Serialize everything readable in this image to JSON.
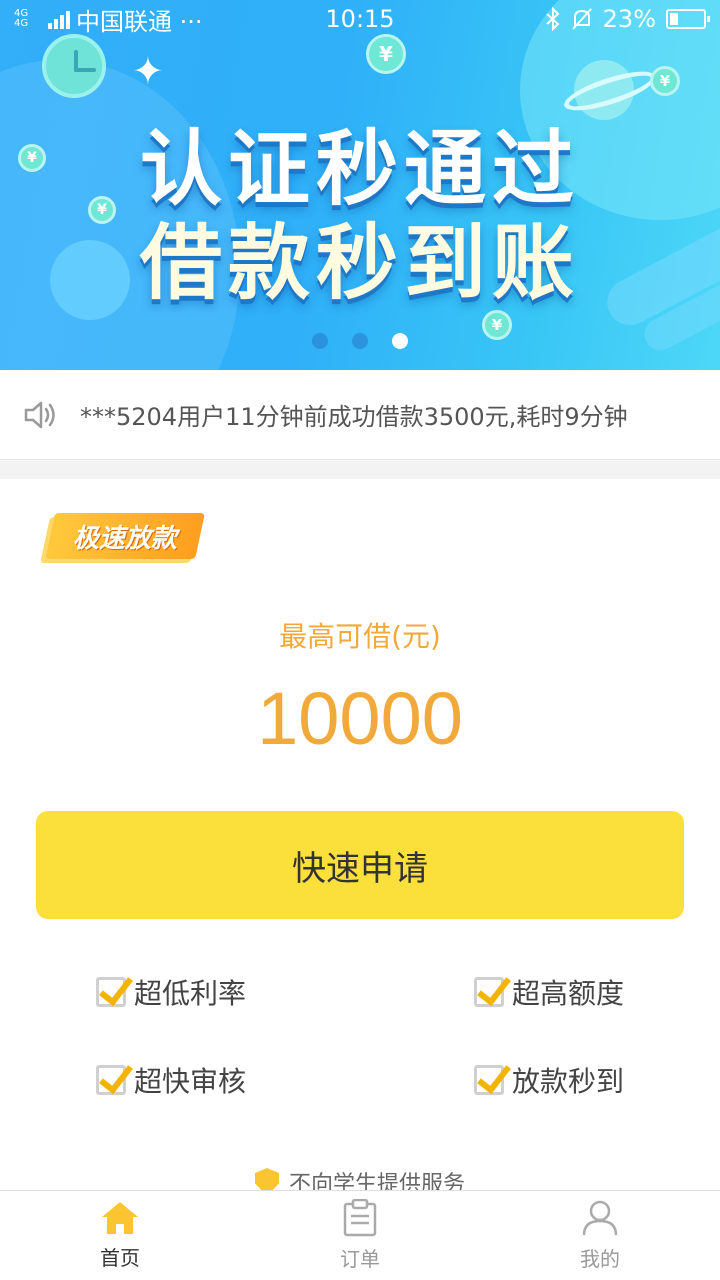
{
  "status_bar": {
    "network": "4G 4G",
    "carrier": "中国联通 ···",
    "time": "10:15",
    "battery": "23%"
  },
  "banner": {
    "line1": "认证秒通过",
    "line2": "借款秒到账",
    "coin_symbol": "¥",
    "slides": 3,
    "active_slide": 3
  },
  "notice": {
    "text": "***5204用户11分钟前成功借款3500元,耗时9分钟"
  },
  "loan": {
    "tag": "极速放款",
    "limit_label": "最高可借(元)",
    "limit_amount": "10000",
    "apply_label": "快速申请"
  },
  "features": [
    {
      "label": "超低利率",
      "checked": true
    },
    {
      "label": "超高额度",
      "checked": true
    },
    {
      "label": "超快审核",
      "checked": true
    },
    {
      "label": "放款秒到",
      "checked": true
    }
  ],
  "footer_note": "不向学生提供服务",
  "tabs": [
    {
      "label": "首页",
      "icon": "home-icon",
      "active": true
    },
    {
      "label": "订单",
      "icon": "clipboard-icon",
      "active": false
    },
    {
      "label": "我的",
      "icon": "user-icon",
      "active": false
    }
  ],
  "colors": {
    "accent_yellow": "#fbdf3b",
    "amount_orange": "#f2a93b",
    "banner_blue": "#2fb0f8",
    "check_gold": "#f2b400"
  }
}
